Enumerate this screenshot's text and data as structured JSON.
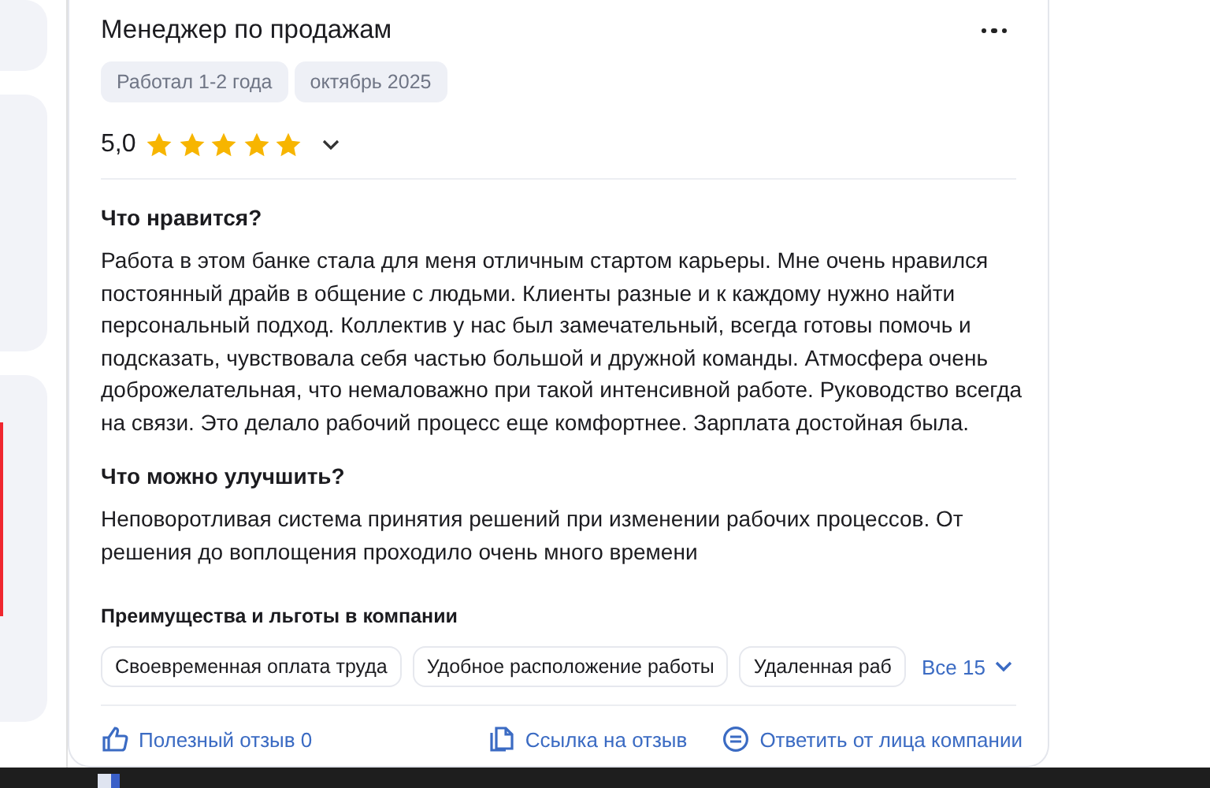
{
  "review": {
    "title": "Менеджер по продажам",
    "tags": [
      "Работал 1-2 года",
      "октябрь 2025"
    ],
    "rating": "5,0",
    "stars": 5,
    "sections": [
      {
        "heading": "Что нравится?",
        "text": "Работа в этом банке стала для меня отличным стартом карьеры. Мне очень нравился постоянный драйв в общение с людьми. Клиенты разные и к каждому нужно найти персональный подход. Коллектив у нас был замечательный, всегда готовы помочь и подсказать, чувствовала себя частью большой и дружной команды. Атмосфера очень доброжелательная, что немаловажно при такой интенсивной работе. Руководство всегда на связи. Это делало рабочий процесс еще комфортнее. Зарплата достойная была."
      },
      {
        "heading": "Что можно улучшить?",
        "text": "Неповоротливая система принятия решений при изменении рабочих процессов. От решения до воплощения проходило очень много времени"
      }
    ],
    "benefits": {
      "heading": "Преимущества и льготы в компании",
      "chips": [
        "Своевременная оплата труда",
        "Удобное расположение работы",
        "Удаленная раб"
      ],
      "more": "Все 15"
    },
    "actions": [
      {
        "kind": "like",
        "label": "Полезный отзыв 0"
      },
      {
        "kind": "link",
        "label": "Ссылка на отзыв"
      },
      {
        "kind": "reply",
        "label": "Ответить от лица компании"
      }
    ]
  }
}
